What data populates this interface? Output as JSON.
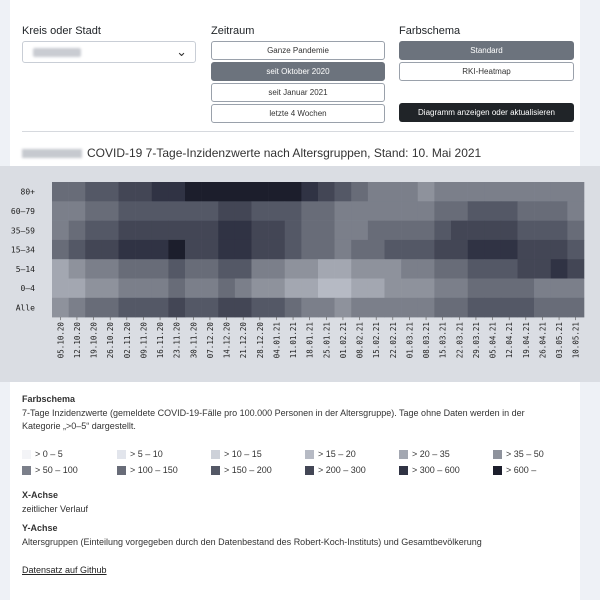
{
  "controls": {
    "region_label": "Kreis oder Stadt",
    "period_label": "Zeitraum",
    "scheme_label": "Farbschema",
    "period_options": [
      "Ganze Pandemie",
      "seit Oktober 2020",
      "seit Januar 2021",
      "letzte 4 Wochen"
    ],
    "scheme_options": [
      "Standard",
      "RKI-Heatmap"
    ],
    "update_button": "Diagramm anzeigen oder aktualisieren"
  },
  "chart_title": "COVID-19 7-Tage-Inzidenzwerte nach Altersgruppen, Stand: 10. Mai 2021",
  "info": {
    "scheme_heading": "Farbschema",
    "scheme_text_1": "7-Tage Inzidenzwerte (gemeldete COVID-19-Fälle pro 100.000 Personen in der Altersgruppe). Tage ohne Daten werden in der",
    "scheme_text_2": "Kategorie „>0–5“ dargestellt.",
    "xaxis_heading": "X-Achse",
    "xaxis_text": "zeitlicher Verlauf",
    "yaxis_heading": "Y-Achse",
    "yaxis_text": "Altersgruppen (Einteilung vorgegeben durch den Datenbestand des Robert-Koch-Instituts) und Gesamtbevölkerung",
    "link": "Datensatz auf Github"
  },
  "legend": [
    {
      "label": "> 0 – 5",
      "color": "#f3f4f7"
    },
    {
      "label": "> 5 – 10",
      "color": "#e2e5ec"
    },
    {
      "label": "> 10 – 15",
      "color": "#cdd1d9"
    },
    {
      "label": "> 15 – 20",
      "color": "#b6bac4"
    },
    {
      "label": "> 20 – 35",
      "color": "#a3a7b1"
    },
    {
      "label": "> 35 – 50",
      "color": "#8e929c"
    },
    {
      "label": "> 50 – 100",
      "color": "#7b7f8a"
    },
    {
      "label": "> 100 – 150",
      "color": "#686c78"
    },
    {
      "label": "> 150 – 200",
      "color": "#545866"
    },
    {
      "label": "> 200 – 300",
      "color": "#434655"
    },
    {
      "label": "> 300 – 600",
      "color": "#303344"
    },
    {
      "label": "> 600 –",
      "color": "#1c1e2c"
    }
  ],
  "chart_data": {
    "type": "heatmap",
    "title": "COVID-19 7-Tage-Inzidenzwerte nach Altersgruppen, Stand: 10. Mai 2021",
    "rows": [
      "80+",
      "60–79",
      "35–59",
      "15–34",
      "5–14",
      "0–4",
      "Alle"
    ],
    "x_tick_labels": [
      "05.10.20",
      "12.10.20",
      "19.10.20",
      "26.10.20",
      "02.11.20",
      "09.11.20",
      "16.11.20",
      "23.11.20",
      "30.11.20",
      "07.12.20",
      "14.12.20",
      "21.12.20",
      "28.12.20",
      "04.01.21",
      "11.01.21",
      "18.01.21",
      "25.01.21",
      "01.02.21",
      "08.02.21",
      "15.02.21",
      "22.02.21",
      "01.03.21",
      "08.03.21",
      "15.03.21",
      "22.03.21",
      "29.03.21",
      "05.04.21",
      "12.04.21",
      "19.04.21",
      "26.04.21",
      "03.05.21",
      "10.05.21"
    ],
    "weekly_category_index": [
      [
        7,
        7,
        8,
        8,
        9,
        9,
        10,
        10,
        11,
        11,
        11,
        11,
        11,
        11,
        11,
        10,
        9,
        8,
        7,
        6,
        6,
        6,
        5,
        6,
        6,
        6,
        6,
        6,
        6,
        6,
        6,
        6
      ],
      [
        6,
        6,
        7,
        7,
        8,
        8,
        8,
        8,
        8,
        8,
        9,
        9,
        8,
        8,
        8,
        7,
        7,
        6,
        6,
        6,
        6,
        6,
        6,
        7,
        7,
        8,
        8,
        8,
        7,
        7,
        7,
        6
      ],
      [
        6,
        7,
        8,
        8,
        9,
        9,
        9,
        9,
        9,
        9,
        10,
        10,
        9,
        9,
        8,
        7,
        7,
        6,
        6,
        7,
        7,
        7,
        7,
        8,
        9,
        9,
        9,
        9,
        8,
        8,
        8,
        7
      ],
      [
        7,
        8,
        9,
        9,
        10,
        10,
        10,
        11,
        9,
        9,
        10,
        10,
        9,
        9,
        8,
        7,
        7,
        6,
        7,
        7,
        8,
        8,
        8,
        9,
        9,
        10,
        10,
        10,
        9,
        9,
        9,
        8
      ],
      [
        4,
        5,
        6,
        6,
        7,
        7,
        7,
        8,
        7,
        7,
        8,
        8,
        6,
        6,
        5,
        5,
        4,
        4,
        5,
        5,
        5,
        6,
        6,
        7,
        7,
        8,
        8,
        8,
        9,
        9,
        10,
        9
      ],
      [
        4,
        4,
        5,
        5,
        6,
        6,
        6,
        7,
        6,
        6,
        7,
        6,
        5,
        5,
        4,
        4,
        3,
        3,
        4,
        4,
        5,
        5,
        5,
        6,
        6,
        7,
        7,
        7,
        7,
        6,
        6,
        6
      ],
      [
        5,
        6,
        7,
        7,
        8,
        8,
        8,
        9,
        8,
        8,
        9,
        9,
        8,
        8,
        7,
        6,
        6,
        5,
        6,
        6,
        6,
        6,
        6,
        7,
        7,
        8,
        8,
        8,
        8,
        7,
        7,
        7
      ]
    ],
    "xlabel": "",
    "ylabel": ""
  }
}
